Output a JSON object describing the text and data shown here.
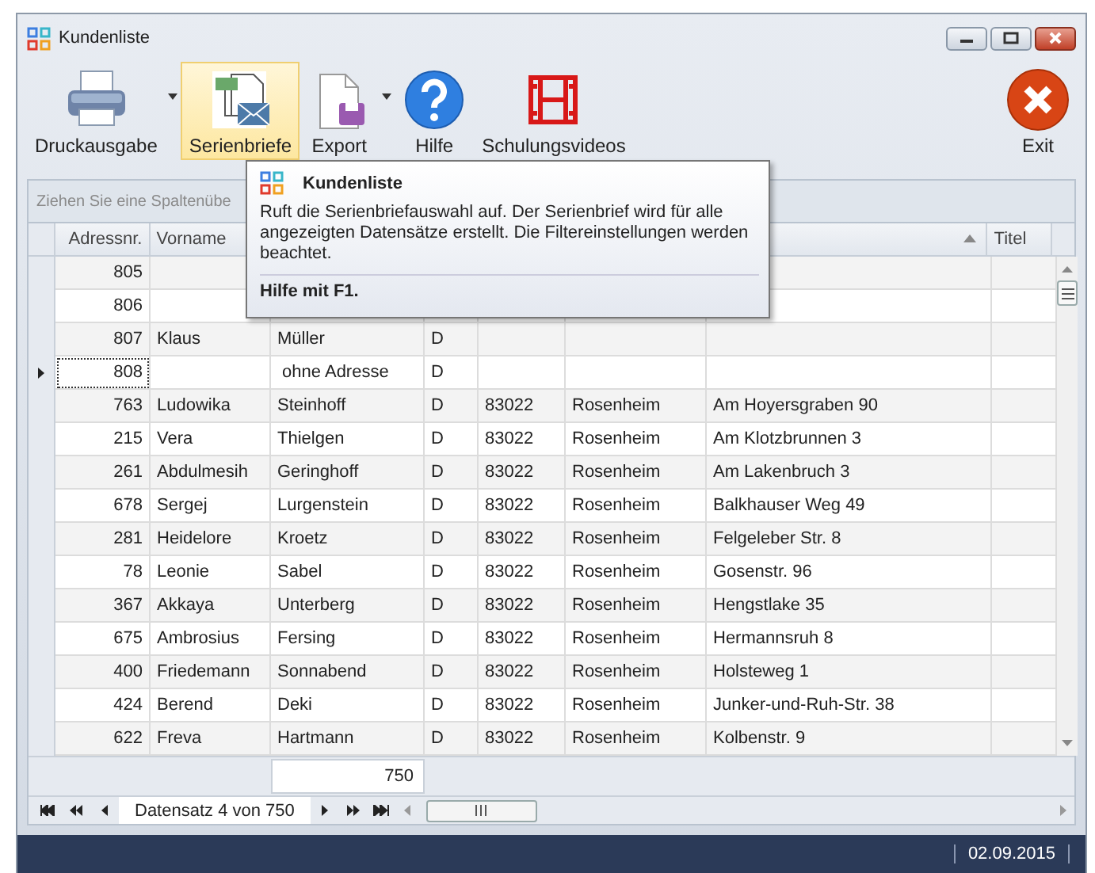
{
  "window": {
    "title": "Kundenliste"
  },
  "toolbar": [
    {
      "label": "Druckausgabe",
      "kind": "print",
      "dropdown": true,
      "hovered": false
    },
    {
      "label": "Serienbriefe",
      "kind": "letters",
      "dropdown": false,
      "hovered": true
    },
    {
      "label": "Export",
      "kind": "export",
      "dropdown": true,
      "hovered": false
    },
    {
      "label": "Hilfe",
      "kind": "help",
      "dropdown": false,
      "hovered": false
    },
    {
      "label": "Schulungsvideos",
      "kind": "video",
      "dropdown": false,
      "hovered": false
    }
  ],
  "exit": {
    "label": "Exit"
  },
  "group_panel": {
    "text": "Ziehen Sie eine Spaltenübe"
  },
  "tooltip": {
    "title": "Kundenliste",
    "text": "Ruft die Serienbriefauswahl auf. Der Serienbrief wird für alle angezeigten Datensätze erstellt. Die Filtereinstellungen werden beachtet.",
    "footer": "Hilfe mit F1."
  },
  "table": {
    "columns": [
      {
        "label": "Adressnr.",
        "sorted": false
      },
      {
        "label": "Vorname",
        "sorted": false
      },
      {},
      {},
      {},
      {},
      {
        "sorted": true
      },
      {
        "label": "Titel",
        "sorted": false
      }
    ],
    "rows": [
      {
        "selected": false,
        "cells": [
          "805",
          "",
          "",
          "",
          "",
          "",
          "",
          ""
        ]
      },
      {
        "selected": false,
        "cells": [
          "806",
          "",
          "",
          "",
          "",
          "",
          "",
          ""
        ]
      },
      {
        "selected": false,
        "cells": [
          "807",
          "Klaus",
          "Müller",
          "D",
          "",
          "",
          "",
          ""
        ]
      },
      {
        "selected": true,
        "cells": [
          "808",
          "",
          " ohne Adresse",
          "D",
          "",
          "",
          "",
          ""
        ]
      },
      {
        "selected": false,
        "cells": [
          "763",
          "Ludowika",
          "Steinhoff",
          "D",
          "83022",
          "Rosenheim",
          "Am Hoyersgraben 90",
          ""
        ]
      },
      {
        "selected": false,
        "cells": [
          "215",
          "Vera",
          "Thielgen",
          "D",
          "83022",
          "Rosenheim",
          "Am Klotzbrunnen 3",
          ""
        ]
      },
      {
        "selected": false,
        "cells": [
          "261",
          "Abdulmesih",
          "Geringhoff",
          "D",
          "83022",
          "Rosenheim",
          "Am Lakenbruch 3",
          ""
        ]
      },
      {
        "selected": false,
        "cells": [
          "678",
          "Sergej",
          "Lurgenstein",
          "D",
          "83022",
          "Rosenheim",
          "Balkhauser Weg 49",
          ""
        ]
      },
      {
        "selected": false,
        "cells": [
          "281",
          "Heidelore",
          "Kroetz",
          "D",
          "83022",
          "Rosenheim",
          "Felgeleber Str. 8",
          ""
        ]
      },
      {
        "selected": false,
        "cells": [
          "78",
          "Leonie",
          "Sabel",
          "D",
          "83022",
          "Rosenheim",
          "Gosenstr. 96",
          ""
        ]
      },
      {
        "selected": false,
        "cells": [
          "367",
          "Akkaya",
          "Unterberg",
          "D",
          "83022",
          "Rosenheim",
          "Hengstlake 35",
          ""
        ]
      },
      {
        "selected": false,
        "cells": [
          "675",
          "Ambrosius",
          "Fersing",
          "D",
          "83022",
          "Rosenheim",
          "Hermannsruh 8",
          ""
        ]
      },
      {
        "selected": false,
        "cells": [
          "400",
          "Friedemann",
          "Sonnabend",
          "D",
          "83022",
          "Rosenheim",
          "Holsteweg 1",
          ""
        ]
      },
      {
        "selected": false,
        "cells": [
          "424",
          "Berend",
          "Deki",
          "D",
          "83022",
          "Rosenheim",
          "Junker-und-Ruh-Str. 38",
          ""
        ]
      },
      {
        "selected": false,
        "cells": [
          "622",
          "Freva",
          "Hartmann",
          "D",
          "83022",
          "Rosenheim",
          "Kolbenstr. 9",
          ""
        ]
      }
    ],
    "summary": {
      "value": "750"
    }
  },
  "navigator": {
    "text": "Datensatz 4 von 750"
  },
  "status_bar": {
    "date": "02.09.2015"
  }
}
